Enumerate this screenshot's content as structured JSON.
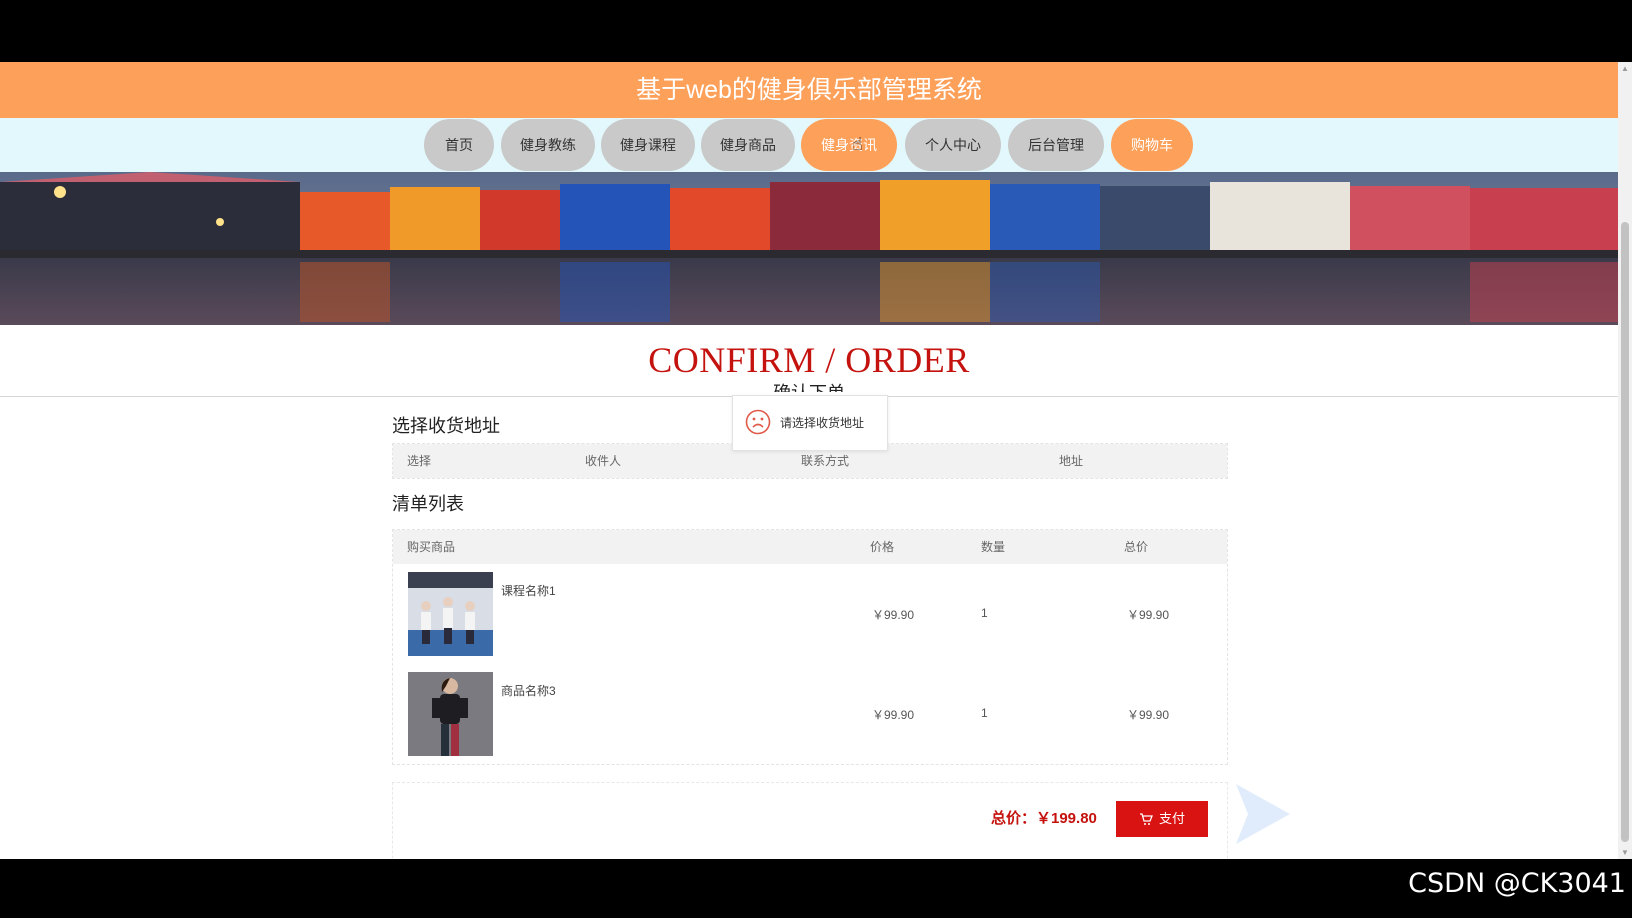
{
  "header": {
    "title": "基于web的健身俱乐部管理系统"
  },
  "nav": {
    "items": [
      {
        "label": "首页",
        "active": false
      },
      {
        "label": "健身教练",
        "active": false
      },
      {
        "label": "健身课程",
        "active": false
      },
      {
        "label": "健身商品",
        "active": false
      },
      {
        "label": "健身资讯",
        "active": true
      },
      {
        "label": "个人中心",
        "active": false
      },
      {
        "label": "后台管理",
        "active": false
      },
      {
        "label": "购物车",
        "active": true
      }
    ]
  },
  "page": {
    "title_en": "CONFIRM / ORDER",
    "title_cn": "确认下单"
  },
  "toast": {
    "message": "请选择收货地址",
    "icon": "sad-face-icon"
  },
  "address": {
    "section_title": "选择收货地址",
    "columns": [
      "选择",
      "收件人",
      "联系方式",
      "地址"
    ]
  },
  "order": {
    "section_title": "清单列表",
    "columns": [
      "购买商品",
      "价格",
      "数量",
      "总价"
    ],
    "items": [
      {
        "name": "课程名称1",
        "price": "￥99.90",
        "qty": "1",
        "total": "￥99.90"
      },
      {
        "name": "商品名称3",
        "price": "￥99.90",
        "qty": "1",
        "total": "￥99.90"
      }
    ]
  },
  "summary": {
    "total_label": "总价：￥199.80",
    "pay_label": "支付"
  },
  "watermark": "CSDN @CK3041",
  "colors": {
    "brand_orange": "#fda05a",
    "nav_bg": "#e3f8fc",
    "accent_red": "#c4120e",
    "pay_red": "#d91312"
  }
}
